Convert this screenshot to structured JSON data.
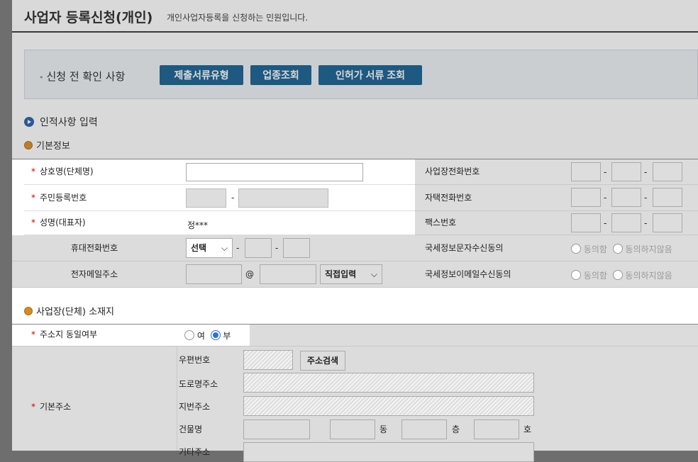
{
  "header": {
    "title": "사업자 등록신청(개인)",
    "description": "개인사업자등록을 신청하는 민원입니다."
  },
  "precheck": {
    "label": "신청 전 확인 사항",
    "buttons": [
      "제출서류유형",
      "업종조회",
      "인허가 서류 조회"
    ]
  },
  "section_personal": {
    "title": "인적사항 입력",
    "sub_title": "기본정보"
  },
  "fields": {
    "company_name": "상호명(단체명)",
    "resident_no": "주민등록번호",
    "name": "성명(대표자)",
    "name_value": "정***",
    "mobile": "휴대전화번호",
    "mobile_select": "선택",
    "email": "전자메일주소",
    "email_at": "@",
    "email_select": "직접입력",
    "biz_phone": "사업장전화번호",
    "home_phone": "자택전화번호",
    "fax": "팩스번호",
    "sms_consent": "국세정보문자수신동의",
    "email_consent": "국세정보이메일수신동의",
    "consent_yes": "동의함",
    "consent_no": "동의하지않음",
    "dash": "-"
  },
  "section_address": {
    "title": "사업장(단체) 소재지",
    "same_address_label": "주소지 동일여부",
    "option_yes": "여",
    "option_no": "부",
    "selected": "부",
    "basic_address": "기본주소",
    "postal_code": "우편번호",
    "address_search": "주소검색",
    "road_address": "도로명주소",
    "lot_address": "지번주소",
    "building_name": "건물명",
    "dong": "동",
    "floor": "층",
    "ho": "호",
    "other_address": "기타주소"
  },
  "colors": {
    "accent_button": "#0f5c8e",
    "required": "#cc0000",
    "radio_selected": "#2c6fe0"
  }
}
